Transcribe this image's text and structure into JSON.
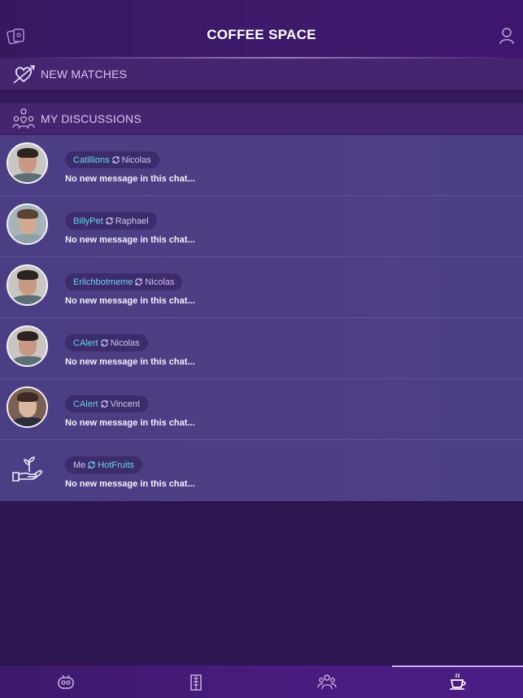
{
  "header": {
    "title": "COFFEE SPACE",
    "left_icon": "cards-icon",
    "right_icon": "user-icon"
  },
  "sections": {
    "matches": {
      "label": "NEW MATCHES",
      "icon": "heart-arrow-icon"
    },
    "discussions": {
      "label": "MY DISCUSSIONS",
      "icon": "people-heart-icon"
    }
  },
  "discussions": [
    {
      "left": "Catillions",
      "right": "Nicolas",
      "message": "No new message in this chat..."
    },
    {
      "left": "BillyPet",
      "right": "Raphael",
      "message": "No new message in this chat..."
    },
    {
      "left": "Erlichbotmeme",
      "right": "Nicolas",
      "message": "No new message in this chat..."
    },
    {
      "left": "CAlert",
      "right": "Nicolas",
      "message": "No new message in this chat..."
    },
    {
      "left": "CAlert",
      "right": "Vincent",
      "message": "No new message in this chat..."
    },
    {
      "left": "Me",
      "right": "HotFruits",
      "message": "No new message in this chat..."
    }
  ],
  "bottom_nav": {
    "tabs": [
      "robot-icon",
      "building-icon",
      "group-icon",
      "coffee-cup-icon"
    ],
    "active": "coffee-cup-icon"
  },
  "colors": {
    "accent_cyan": "#6fd0e8",
    "pill_bg": "#3c2c6c",
    "row_bg": "#4c3e84",
    "active_tab_line": "#c7b4ea"
  }
}
